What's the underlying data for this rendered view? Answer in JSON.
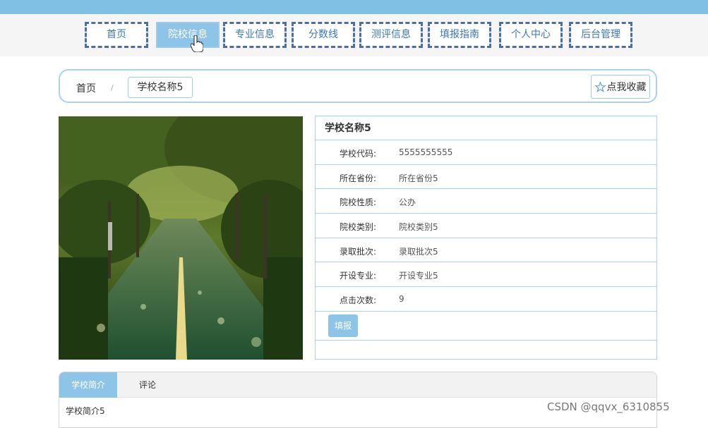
{
  "nav": {
    "items": [
      {
        "label": "首页"
      },
      {
        "label": "院校信息"
      },
      {
        "label": "专业信息"
      },
      {
        "label": "分数线"
      },
      {
        "label": "测评信息"
      },
      {
        "label": "填报指南"
      },
      {
        "label": "个人中心"
      },
      {
        "label": "后台管理"
      }
    ],
    "active": "院校信息"
  },
  "breadcrumb": {
    "home": "首页",
    "separator": "/",
    "current": "学校名称5",
    "favorite_label": "点我收藏"
  },
  "school": {
    "name": "学校名称5",
    "fields": [
      {
        "label": "学校代码:",
        "value": "5555555555"
      },
      {
        "label": "所在省份:",
        "value": "所在省份5"
      },
      {
        "label": "院校性质:",
        "value": "公办"
      },
      {
        "label": "院校类别:",
        "value": "院校类别5"
      },
      {
        "label": "录取批次:",
        "value": "录取批次5"
      },
      {
        "label": "开设专业:",
        "value": "开设专业5"
      },
      {
        "label": "点击次数:",
        "value": "9"
      }
    ],
    "apply_label": "填报"
  },
  "tabs": {
    "items": [
      {
        "label": "学校简介"
      },
      {
        "label": "评论"
      }
    ],
    "active_content": "学校简介5"
  },
  "watermark": "CSDN @qqvx_6310855",
  "colors": {
    "accent": "#8dc4e8",
    "top_strip": "#7fc0e4",
    "nav_border": "#4a6fa5",
    "border": "#a9d3ec"
  }
}
